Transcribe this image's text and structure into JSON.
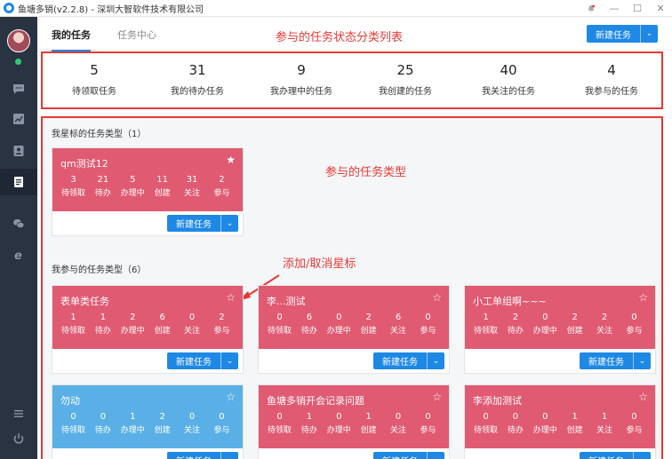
{
  "window": {
    "title": "鱼塘多销(v2.2.8) - 深圳大智软件技术有限公司"
  },
  "tabs": [
    {
      "label": "我的任务",
      "active": true
    },
    {
      "label": "任务中心",
      "active": false
    }
  ],
  "new_task_button": "新建任务",
  "annotations": {
    "stats": "参与的任务状态分类列表",
    "types": "参与的任务类型",
    "star": "添加/取消星标"
  },
  "stats": [
    {
      "value": "5",
      "label": "待领取任务"
    },
    {
      "value": "31",
      "label": "我的待办任务"
    },
    {
      "value": "9",
      "label": "我办理中的任务"
    },
    {
      "value": "25",
      "label": "我创建的任务"
    },
    {
      "value": "40",
      "label": "我关注的任务"
    },
    {
      "value": "4",
      "label": "我参与的任务"
    }
  ],
  "starred_section": {
    "title": "我星标的任务类型（1）",
    "cards": [
      {
        "name": "qm测试12",
        "starred": true,
        "color": "#e05a72",
        "counts": [
          "3",
          "21",
          "5",
          "11",
          "31",
          "2"
        ]
      }
    ]
  },
  "participating_section": {
    "title": "我参与的任务类型（6）",
    "cards": [
      {
        "name": "表单类任务",
        "starred": false,
        "color": "#e05a72",
        "counts": [
          "1",
          "1",
          "2",
          "6",
          "0",
          "2"
        ]
      },
      {
        "name": "李...测试",
        "starred": false,
        "color": "#e05a72",
        "counts": [
          "0",
          "6",
          "0",
          "2",
          "6",
          "0"
        ]
      },
      {
        "name": "小工单组啊~~~",
        "starred": false,
        "color": "#e05a72",
        "counts": [
          "1",
          "2",
          "0",
          "2",
          "2",
          "0"
        ]
      },
      {
        "name": "勿动",
        "starred": false,
        "color": "#5ab0e6",
        "counts": [
          "0",
          "0",
          "1",
          "2",
          "0",
          "0"
        ]
      },
      {
        "name": "鱼塘多销开会记录问题",
        "starred": false,
        "color": "#e05a72",
        "counts": [
          "0",
          "1",
          "0",
          "1",
          "0",
          "0"
        ]
      },
      {
        "name": "李添加测试",
        "starred": false,
        "color": "#e05a72",
        "counts": [
          "0",
          "0",
          "0",
          "1",
          "1",
          "0"
        ]
      }
    ]
  },
  "count_labels": [
    "待领取",
    "待办",
    "办理中",
    "创建",
    "关注",
    "参与"
  ],
  "icons": {
    "sidebar": [
      "chat-icon",
      "chart-icon",
      "contact-icon",
      "task-icon",
      "wechat-icon",
      "browser-icon"
    ],
    "bottom": [
      "menu-icon",
      "power-icon"
    ]
  }
}
